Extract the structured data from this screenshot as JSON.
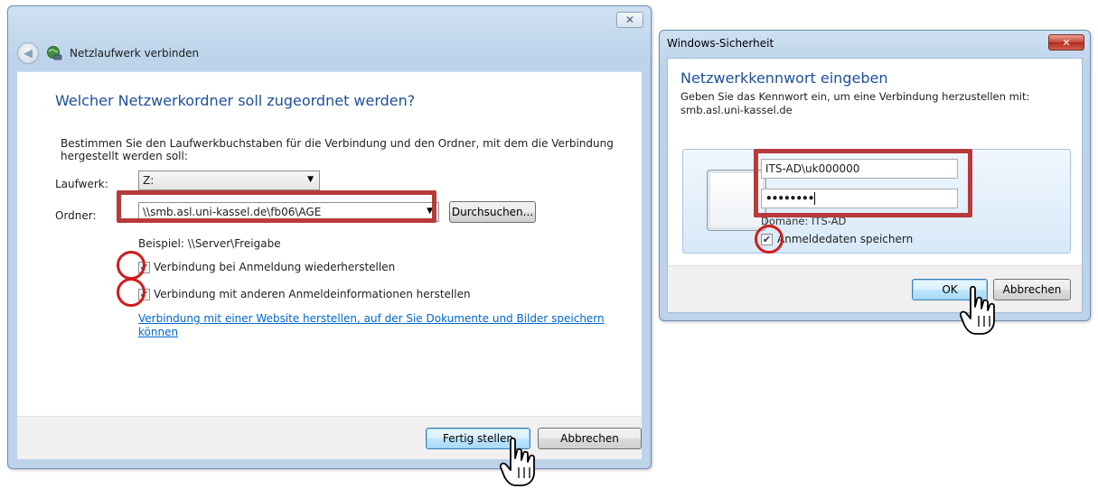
{
  "wizard": {
    "title": "Netzlaufwerk verbinden",
    "close_glyph": "✕",
    "main_instruction": "Welcher Netzwerkordner soll zugeordnet werden?",
    "description": "Bestimmen Sie den Laufwerkbuchstaben für die Verbindung und den Ordner, mit dem die Verbindung hergestellt werden soll:",
    "drive_label": "Laufwerk:",
    "drive_value": "Z:",
    "folder_label": "Ordner:",
    "folder_value": "\\\\smb.asl.uni-kassel.de\\fb06\\AGE",
    "browse_button": "Durchsuchen...",
    "example": "Beispiel: \\\\Server\\Freigabe",
    "reconnect_label": "Verbindung bei Anmeldung wiederherstellen",
    "reconnect_checked": true,
    "other_creds_label": "Verbindung mit anderen Anmeldeinformationen herstellen",
    "other_creds_checked": true,
    "website_link_line1": "Verbindung mit einer Website herstellen, auf der Sie Dokumente und Bilder speichern",
    "website_link_line2": "können",
    "finish_button": "Fertig stellen",
    "cancel_button": "Abbrechen"
  },
  "security": {
    "window_title": "Windows-Sicherheit",
    "close_glyph": "✕",
    "heading": "Netzwerkkennwort eingeben",
    "instruction": "Geben Sie das Kennwort ein, um eine Verbindung herzustellen mit:",
    "server": "smb.asl.uni-kassel.de",
    "username_value": "ITS-AD\\uk000000",
    "password_value": "••••••••",
    "domain_text": "Domäne: ITS-AD",
    "remember_label": "Anmeldedaten speichern",
    "remember_checked": true,
    "ok_button": "OK",
    "cancel_button": "Abbrechen"
  },
  "colors": {
    "annotation_red": "#b83a3a",
    "heading_blue": "#1e4f98",
    "link_blue": "#0066cc"
  }
}
